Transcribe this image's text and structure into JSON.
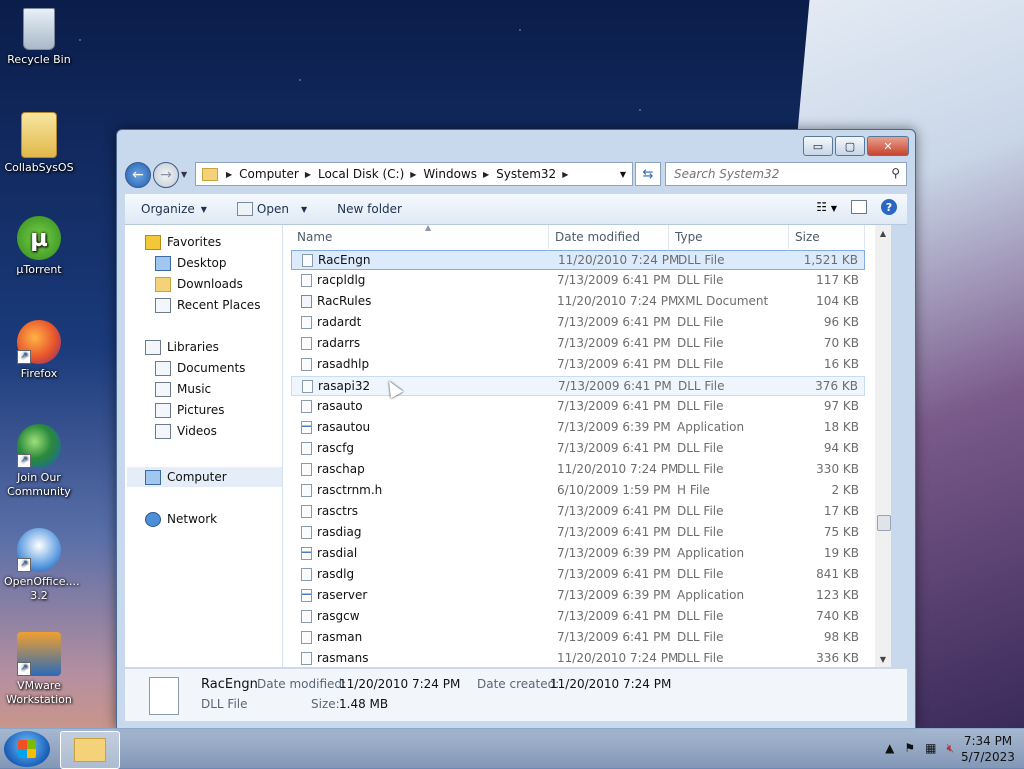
{
  "desktop": {
    "icons": [
      {
        "label": "Recycle Bin"
      },
      {
        "label": "CollabSysOS"
      },
      {
        "label": "µTorrent"
      },
      {
        "label": "Firefox"
      },
      {
        "label": "Join Our Community"
      },
      {
        "label": "OpenOffice.... 3.2"
      },
      {
        "label": "VMware Workstation"
      }
    ]
  },
  "window": {
    "controls": {
      "minimize": "▭",
      "maximize": "▢",
      "close": "✕"
    },
    "address": {
      "crumbs": [
        "Computer",
        "Local Disk (C:)",
        "Windows",
        "System32"
      ]
    },
    "search": {
      "placeholder": "Search System32"
    },
    "toolbar": {
      "organize": "Organize",
      "open": "Open",
      "new_folder": "New folder"
    },
    "nav": {
      "favorites": "Favorites",
      "desktop": "Desktop",
      "downloads": "Downloads",
      "recent": "Recent Places",
      "libraries": "Libraries",
      "documents": "Documents",
      "music": "Music",
      "pictures": "Pictures",
      "videos": "Videos",
      "computer": "Computer",
      "network": "Network"
    },
    "columns": {
      "name": "Name",
      "date": "Date modified",
      "type": "Type",
      "size": "Size"
    },
    "files": [
      {
        "name": "RacEngn",
        "date": "11/20/2010 7:24 PM",
        "type": "DLL File",
        "size": "1,521 KB"
      },
      {
        "name": "racpldlg",
        "date": "7/13/2009 6:41 PM",
        "type": "DLL File",
        "size": "117 KB"
      },
      {
        "name": "RacRules",
        "date": "11/20/2010 7:24 PM",
        "type": "XML Document",
        "size": "104 KB"
      },
      {
        "name": "radardt",
        "date": "7/13/2009 6:41 PM",
        "type": "DLL File",
        "size": "96 KB"
      },
      {
        "name": "radarrs",
        "date": "7/13/2009 6:41 PM",
        "type": "DLL File",
        "size": "70 KB"
      },
      {
        "name": "rasadhlp",
        "date": "7/13/2009 6:41 PM",
        "type": "DLL File",
        "size": "16 KB"
      },
      {
        "name": "rasapi32",
        "date": "7/13/2009 6:41 PM",
        "type": "DLL File",
        "size": "376 KB"
      },
      {
        "name": "rasauto",
        "date": "7/13/2009 6:41 PM",
        "type": "DLL File",
        "size": "97 KB"
      },
      {
        "name": "rasautou",
        "date": "7/13/2009 6:39 PM",
        "type": "Application",
        "size": "18 KB"
      },
      {
        "name": "rascfg",
        "date": "7/13/2009 6:41 PM",
        "type": "DLL File",
        "size": "94 KB"
      },
      {
        "name": "raschap",
        "date": "11/20/2010 7:24 PM",
        "type": "DLL File",
        "size": "330 KB"
      },
      {
        "name": "rasctrnm.h",
        "date": "6/10/2009 1:59 PM",
        "type": "H File",
        "size": "2 KB"
      },
      {
        "name": "rasctrs",
        "date": "7/13/2009 6:41 PM",
        "type": "DLL File",
        "size": "17 KB"
      },
      {
        "name": "rasdiag",
        "date": "7/13/2009 6:41 PM",
        "type": "DLL File",
        "size": "75 KB"
      },
      {
        "name": "rasdial",
        "date": "7/13/2009 6:39 PM",
        "type": "Application",
        "size": "19 KB"
      },
      {
        "name": "rasdlg",
        "date": "7/13/2009 6:41 PM",
        "type": "DLL File",
        "size": "841 KB"
      },
      {
        "name": "raserver",
        "date": "7/13/2009 6:39 PM",
        "type": "Application",
        "size": "123 KB"
      },
      {
        "name": "rasgcw",
        "date": "7/13/2009 6:41 PM",
        "type": "DLL File",
        "size": "740 KB"
      },
      {
        "name": "rasman",
        "date": "7/13/2009 6:41 PM",
        "type": "DLL File",
        "size": "98 KB"
      },
      {
        "name": "rasmans",
        "date": "11/20/2010 7:24 PM",
        "type": "DLL File",
        "size": "336 KB"
      }
    ],
    "details": {
      "name": "RacEngn",
      "type": "DLL File",
      "modified_label": "Date modified:",
      "modified": "11/20/2010 7:24 PM",
      "created_label": "Date created:",
      "created": "11/20/2010 7:24 PM",
      "size_label": "Size:",
      "size": "1.48 MB"
    }
  },
  "taskbar": {
    "time": "7:34 PM",
    "date": "5/7/2023"
  }
}
